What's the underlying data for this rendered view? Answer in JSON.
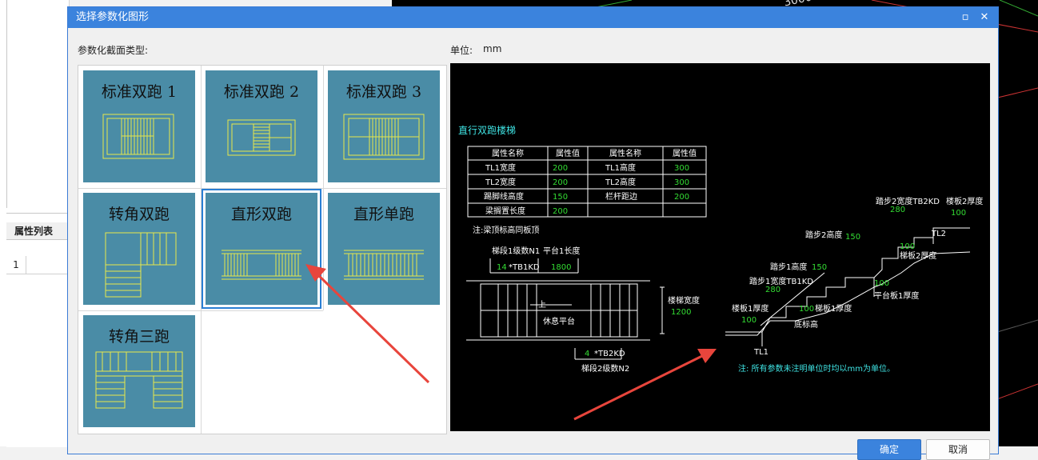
{
  "background": {
    "panel_tab": "属性列表",
    "row_number": "1",
    "canvas_text": "3000"
  },
  "dialog": {
    "title": "选择参数化图形",
    "section_label": "参数化截面类型:",
    "unit_label": "单位:",
    "unit_value": "mm",
    "ok_label": "确定",
    "cancel_label": "取消"
  },
  "tiles": [
    {
      "name": "标准双跑 1"
    },
    {
      "name": "标准双跑 2"
    },
    {
      "name": "标准双跑 3"
    },
    {
      "name": "转角双跑"
    },
    {
      "name": "直形双跑",
      "selected": true
    },
    {
      "name": "直形单跑"
    },
    {
      "name": "转角三跑"
    }
  ],
  "preview": {
    "title": "直行双跑楼梯",
    "table_headers": [
      "属性名称",
      "属性值",
      "属性名称",
      "属性值"
    ],
    "table_rows": [
      [
        "TL1宽度",
        "200",
        "TL1高度",
        "300"
      ],
      [
        "TL2宽度",
        "200",
        "TL2高度",
        "300"
      ],
      [
        "踢脚线高度",
        "150",
        "栏杆距边",
        "200"
      ],
      [
        "梁搁置长度",
        "200",
        "",
        ""
      ]
    ],
    "beam_note": "注:梁顶标高同板顶",
    "plan": {
      "n1_label": "梯段1级数N1",
      "platform_label": "平台1长度",
      "n1_value": "14",
      "n1_code": "*TB1KD",
      "platform_value": "1800",
      "up_label": "上",
      "rest_label": "休息平台",
      "width_label": "楼梯宽度",
      "width_value": "1200",
      "n2_value": "4",
      "n2_code": "*TB2KD",
      "n2_label": "梯段2级数N2"
    },
    "section": {
      "step2_width": "踏步2宽度TB2KD",
      "step2_width_val": "280",
      "slab2_thick": "楼板2厚度",
      "slab2_val": "100",
      "step2_height": "踏步2高度",
      "step2_height_val": "150",
      "tl2": "TL2",
      "run2_thick": "梯板2厚度",
      "run2_val": "100",
      "step1_height": "踏步1高度",
      "step1_height_val": "150",
      "step1_width": "踏步1宽度TB1KD",
      "step1_width_val": "280",
      "platform1_val": "100",
      "platform1_thick": "平台板1厚度",
      "slab1_thick": "楼板1厚度",
      "run1_val": "100",
      "run1_thick": "梯板1厚度",
      "slab1_val": "100",
      "base_elev": "底标高",
      "tl1": "TL1"
    },
    "footnote": "注: 所有参数未注明单位时均以mm为单位。"
  },
  "colors": {
    "accent": "#3b83dd",
    "tile_bg": "#4a8ca6",
    "drawing_yellow": "#e8e84a",
    "drawing_green": "#33dd33",
    "drawing_cyan": "#3fe3e3",
    "arrow_red": "#e8453c"
  }
}
